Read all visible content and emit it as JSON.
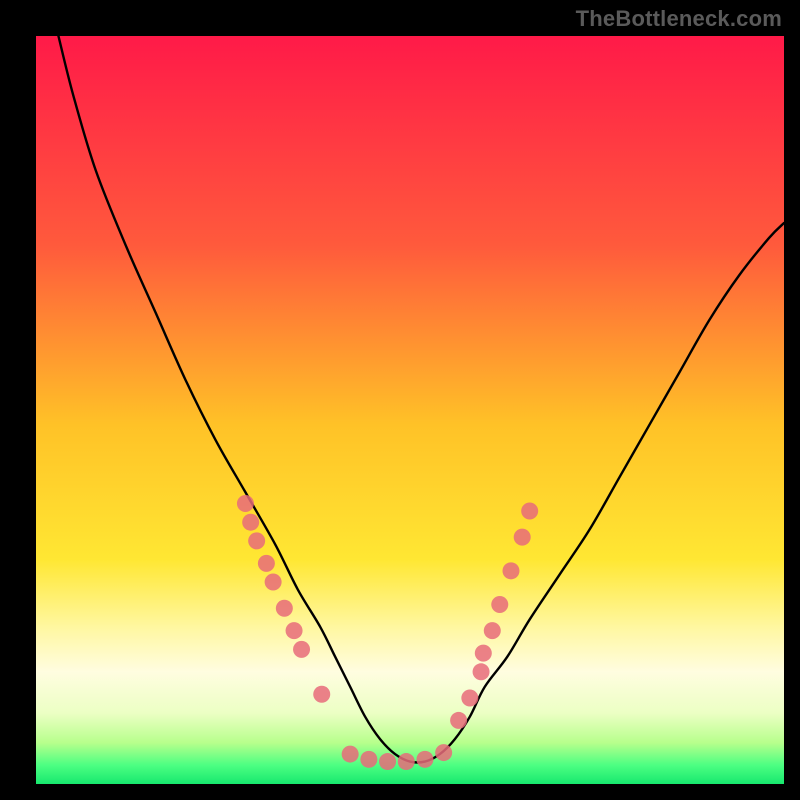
{
  "watermark": "TheBottleneck.com",
  "chart_data": {
    "type": "line",
    "title": "",
    "xlabel": "",
    "ylabel": "",
    "xlim": [
      0,
      100
    ],
    "ylim": [
      0,
      100
    ],
    "gradient_stops": [
      {
        "offset": 0.0,
        "color": "#ff1a48"
      },
      {
        "offset": 0.28,
        "color": "#ff5a3c"
      },
      {
        "offset": 0.52,
        "color": "#ffc227"
      },
      {
        "offset": 0.7,
        "color": "#ffe733"
      },
      {
        "offset": 0.79,
        "color": "#fff7a0"
      },
      {
        "offset": 0.85,
        "color": "#fffde0"
      },
      {
        "offset": 0.905,
        "color": "#ecffc4"
      },
      {
        "offset": 0.945,
        "color": "#b7ff8c"
      },
      {
        "offset": 0.975,
        "color": "#4cff82"
      },
      {
        "offset": 1.0,
        "color": "#17e86e"
      }
    ],
    "curve": {
      "x": [
        3,
        5,
        8,
        12,
        16,
        20,
        24,
        28,
        32,
        35,
        38,
        40,
        42,
        44,
        46,
        48,
        50,
        52,
        54,
        56,
        58,
        60,
        63,
        66,
        70,
        74,
        78,
        82,
        86,
        90,
        94,
        98,
        100
      ],
      "y": [
        100,
        92,
        82,
        72,
        63,
        54,
        46,
        39,
        32,
        26,
        21,
        17,
        13,
        9,
        6,
        4,
        3,
        3,
        4,
        6,
        9,
        13,
        17,
        22,
        28,
        34,
        41,
        48,
        55,
        62,
        68,
        73,
        75
      ]
    },
    "series": [
      {
        "name": "left-branch-dots",
        "color": "#e76b7a",
        "x": [
          28.0,
          28.7,
          29.5,
          30.8,
          31.7,
          33.2,
          34.5,
          35.5,
          38.2
        ],
        "y": [
          37.5,
          35.0,
          32.5,
          29.5,
          27.0,
          23.5,
          20.5,
          18.0,
          12.0
        ]
      },
      {
        "name": "valley-dots",
        "color": "#e76b7a",
        "x": [
          42.0,
          44.5,
          47.0,
          49.5,
          52.0,
          54.5
        ],
        "y": [
          4.0,
          3.3,
          3.0,
          3.0,
          3.3,
          4.2
        ]
      },
      {
        "name": "right-branch-dots",
        "color": "#e76b7a",
        "x": [
          56.5,
          58.0,
          59.5,
          59.8,
          61.0,
          62.0,
          63.5,
          65.0,
          66.0
        ],
        "y": [
          8.5,
          11.5,
          15.0,
          17.5,
          20.5,
          24.0,
          28.5,
          33.0,
          36.5
        ]
      }
    ]
  }
}
